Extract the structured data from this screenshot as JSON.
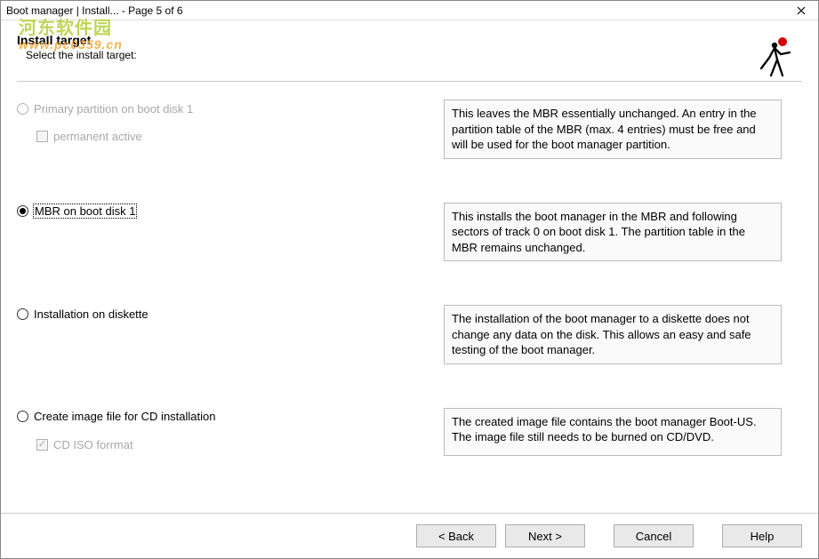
{
  "window": {
    "title": "Boot manager | Install...   -   Page 5 of 6"
  },
  "header": {
    "heading": "Install target",
    "subtitle": "Select the install target:"
  },
  "watermark": {
    "line1": "河东软件园",
    "line2": "www.pc0359.cn"
  },
  "options": {
    "primary": {
      "label": "Primary partition on boot disk 1",
      "sub_label": "permanent active",
      "description": "This leaves the MBR essentially unchanged. An entry in the partition table of the MBR (max. 4 entries) must be free and will be used for the boot manager partition."
    },
    "mbr": {
      "label": "MBR on boot disk 1",
      "description": "This installs the boot manager in the MBR and following sectors of track 0 on boot disk 1. The partition table in the MBR remains unchanged."
    },
    "diskette": {
      "label": "Installation on diskette",
      "description": "The installation of the boot manager to a diskette does not change any data on the disk. This allows an easy and safe testing of the boot manager."
    },
    "cdimage": {
      "label": "Create image file for CD installation",
      "sub_label": "CD ISO forrmat",
      "description": "The created image file contains the boot manager Boot-US. The image file still needs to be burned on CD/DVD."
    }
  },
  "buttons": {
    "back": "< Back",
    "next": "Next >",
    "cancel": "Cancel",
    "help": "Help"
  }
}
